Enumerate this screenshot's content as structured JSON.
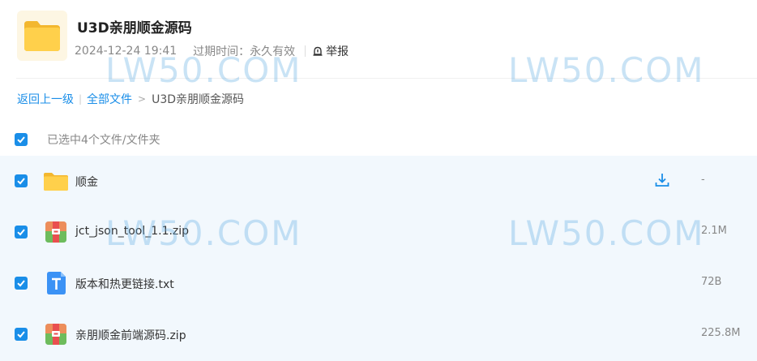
{
  "share": {
    "title": "U3D亲朋顺金源码",
    "date": "2024-12-24 19:41",
    "expire": "过期时间：永久有效",
    "report": "举报"
  },
  "breadcrumb": {
    "back": "返回上一级",
    "all_files": "全部文件",
    "current": "U3D亲朋顺金源码"
  },
  "select_all": {
    "label": "已选中4个文件/文件夹",
    "checked": true
  },
  "files": [
    {
      "name": "顺金",
      "size": "-",
      "type": "folder",
      "checked": true,
      "download_icon": "download-icon"
    },
    {
      "name": "jct_json_tool_1.1.zip",
      "size": "2.1M",
      "type": "zip",
      "checked": true
    },
    {
      "name": "版本和热更链接.txt",
      "size": "72B",
      "type": "txt",
      "checked": true
    },
    {
      "name": "亲朋顺金前端源码.zip",
      "size": "225.8M",
      "type": "zip",
      "checked": true
    }
  ],
  "watermark": "LW50.COM",
  "colors": {
    "accent": "#1a8ee8",
    "folder": "#f7c344",
    "row_bg": "#f2f8fd"
  }
}
